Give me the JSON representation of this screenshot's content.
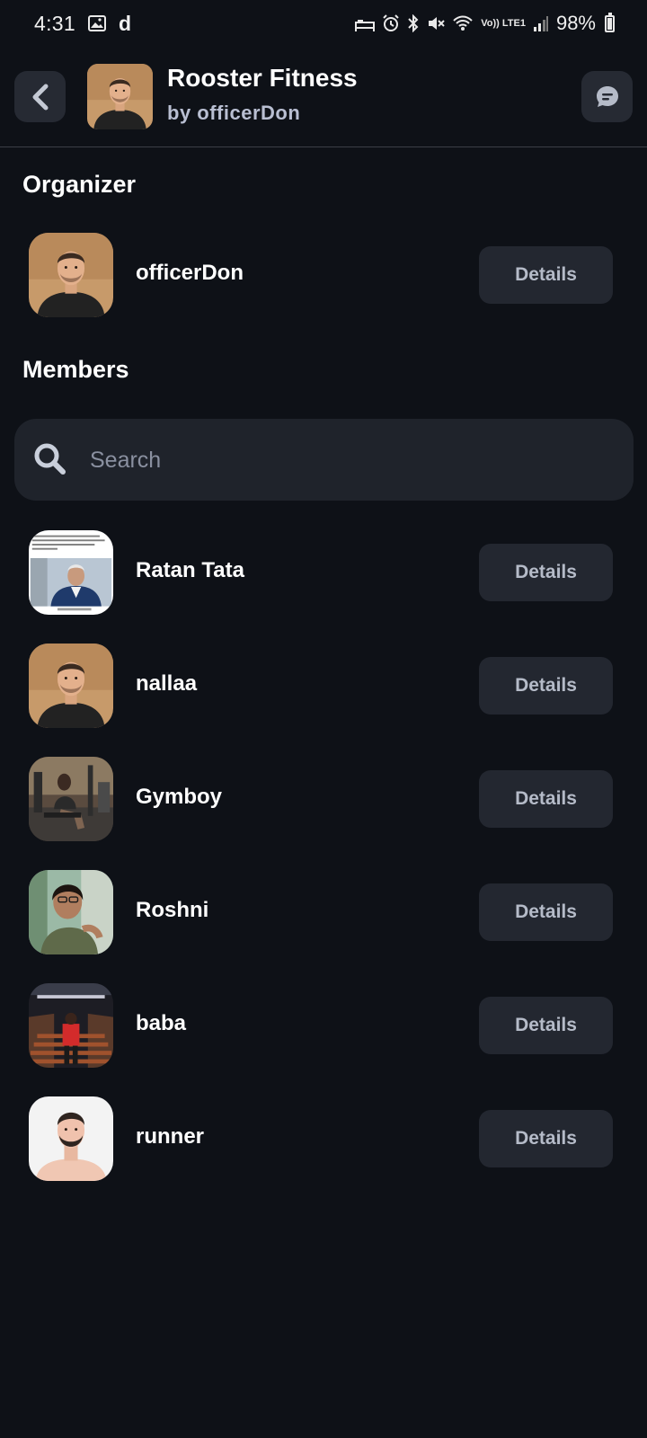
{
  "status_bar": {
    "time": "4:31",
    "app_letter": "d",
    "network": "Vo)) LTE1",
    "battery_text": "98%",
    "battery_level": 0.98
  },
  "header": {
    "title": "Rooster Fitness",
    "subtitle": "by officerDon"
  },
  "organizer": {
    "section_title": "Organizer",
    "name": "officerDon",
    "details_label": "Details"
  },
  "members": {
    "section_title": "Members",
    "search_placeholder": "Search",
    "items": [
      {
        "name": "Ratan Tata",
        "details_label": "Details"
      },
      {
        "name": "nallaa",
        "details_label": "Details"
      },
      {
        "name": "Gymboy",
        "details_label": "Details"
      },
      {
        "name": "Roshni",
        "details_label": "Details"
      },
      {
        "name": "baba",
        "details_label": "Details"
      },
      {
        "name": "runner",
        "details_label": "Details"
      }
    ]
  },
  "colors": {
    "background": "#0e1117",
    "button_bg": "#232730",
    "search_bg": "#1f232b",
    "subtitle": "#b9bfd2"
  }
}
